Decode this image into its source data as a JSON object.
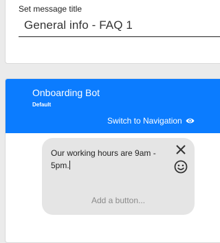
{
  "title_section": {
    "label": "Set message title",
    "value": "General info - FAQ 1"
  },
  "bot": {
    "name": "Onboarding Bot",
    "subtitle": "Default",
    "switch_label": "Switch to Navigation",
    "switch_icon": "eye-icon",
    "header_color": "#0b7cff"
  },
  "message": {
    "text": "Our working hours are 9am - 5pm.",
    "close_icon": "close-icon",
    "emoji_icon": "smiley-icon",
    "add_button_placeholder": "Add a button..."
  }
}
